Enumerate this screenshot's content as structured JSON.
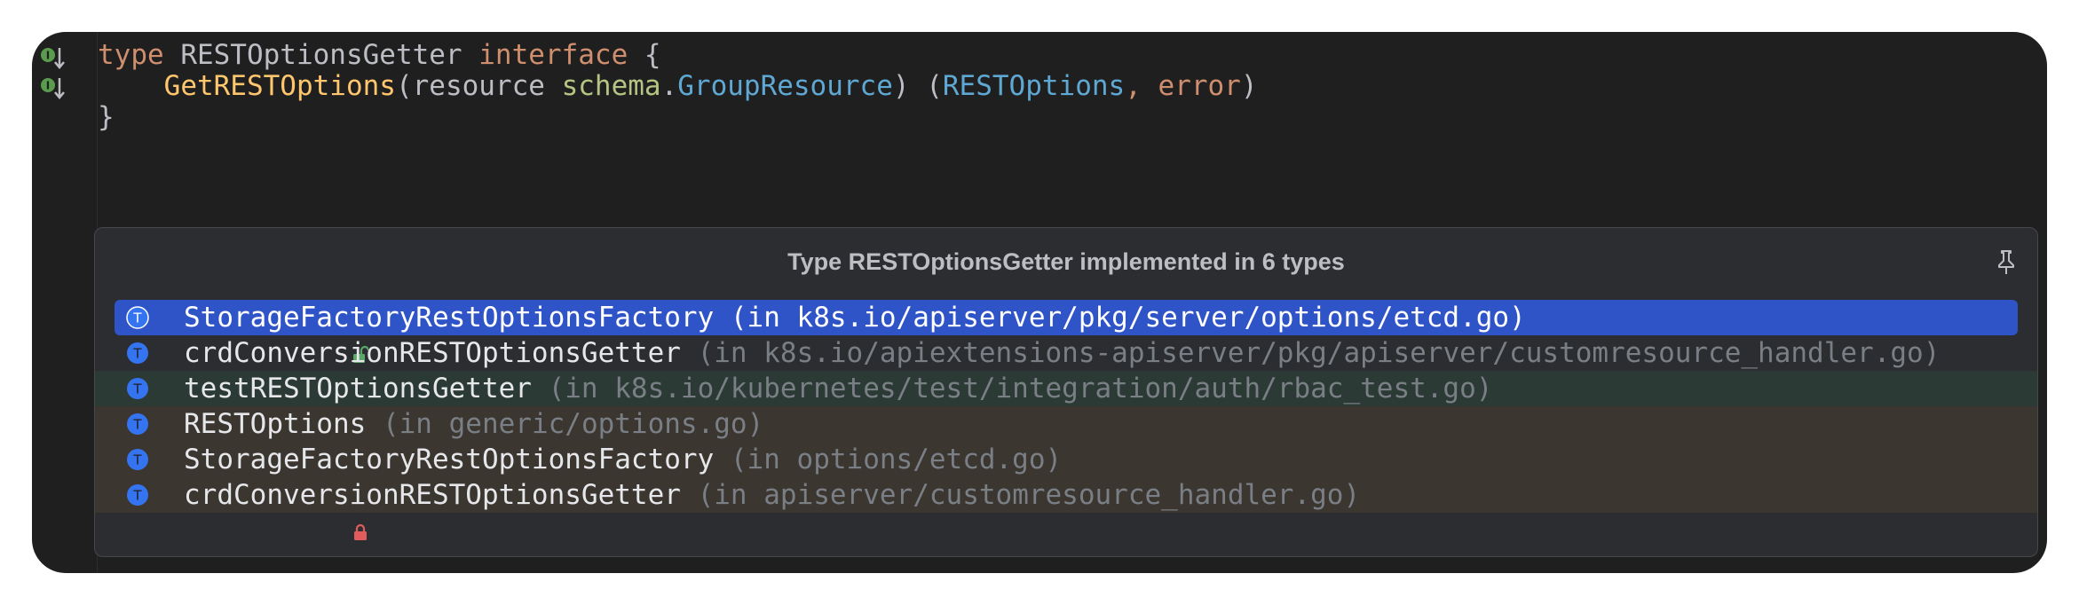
{
  "editor": {
    "code": {
      "line1": {
        "kw_type": "type",
        "name": " RESTOptionsGetter ",
        "kw_interface": "interface",
        "brace": " {"
      },
      "line2": {
        "indent": "    ",
        "fn": "GetRESTOptions",
        "open": "(resource ",
        "pkg": "schema",
        "dot": ".",
        "type": "GroupResource",
        "mid": ") (",
        "ret_type": "RESTOptions",
        "comma": ", ",
        "ret_err": "error",
        "close": ")"
      },
      "line3": {
        "brace": "}"
      }
    },
    "gutter_icons": [
      "implemented-down-icon",
      "implemented-down-icon"
    ]
  },
  "popup": {
    "title": "Type RESTOptionsGetter implemented in 6 types",
    "pin_icon": "pin-icon",
    "items": [
      {
        "name": "StorageFactoryRestOptionsFactory",
        "location": " (in k8s.io/apiserver/pkg/server/options/etcd.go)",
        "access": "public",
        "kind": "T",
        "scope": "selected"
      },
      {
        "name": "crdConversionRESTOptionsGetter",
        "location": " (in k8s.io/apiextensions-apiserver/pkg/apiserver/customresource_handler.go)",
        "access": "private",
        "kind": "T",
        "scope": "project"
      },
      {
        "name": "testRESTOptionsGetter",
        "location": " (in k8s.io/kubernetes/test/integration/auth/rbac_test.go)",
        "access": "private",
        "kind": "T",
        "scope": "test"
      },
      {
        "name": "RESTOptions",
        "location": " (in generic/options.go)",
        "access": "public",
        "kind": "T",
        "scope": "library"
      },
      {
        "name": "StorageFactoryRestOptionsFactory",
        "location": " (in options/etcd.go)",
        "access": "public",
        "kind": "T",
        "scope": "library"
      },
      {
        "name": "crdConversionRESTOptionsGetter",
        "location": " (in apiserver/customresource_handler.go)",
        "access": "private",
        "kind": "T",
        "scope": "library"
      }
    ]
  },
  "colors": {
    "editor_bg": "#1f1f20",
    "popup_bg": "#2b2d30",
    "selected_bg": "#2f54c7",
    "test_row_bg": "#2b3a35",
    "library_row_bg": "#3b3630",
    "keyword": "#cf8e6d",
    "function": "#ffc66d",
    "package": "#b4c482",
    "type": "#5fa8d3",
    "lock_public": "#59a869",
    "lock_private": "#e05c5c",
    "type_icon": "#3574f0"
  }
}
